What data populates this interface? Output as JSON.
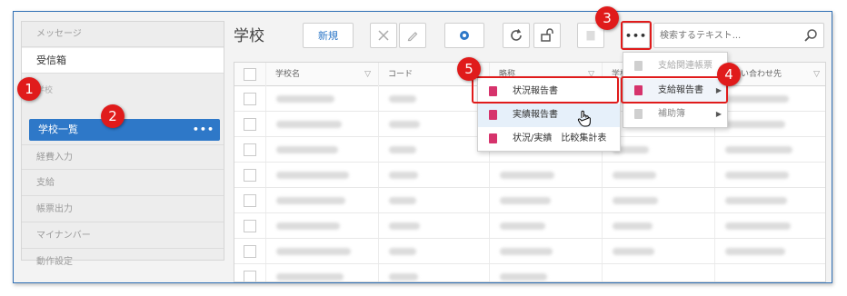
{
  "sidebar": {
    "items": [
      {
        "label": "メッセージ"
      },
      {
        "label": "受信箱"
      },
      {
        "label": "学校"
      },
      {
        "label": "学校一覧"
      },
      {
        "label": "経費入力"
      },
      {
        "label": "支給"
      },
      {
        "label": "帳票出力"
      },
      {
        "label": "マイナンバー"
      },
      {
        "label": "動作設定"
      }
    ],
    "active_more": "•••"
  },
  "header": {
    "title": "学校",
    "new_label": "新規",
    "more_label": "•••"
  },
  "search": {
    "placeholder": "検索するテキスト..."
  },
  "grid": {
    "columns": [
      "学校名",
      "コード",
      "略称",
      "学校",
      "等問い合わせ先"
    ]
  },
  "menu_main": {
    "items": [
      {
        "label": "支給関連帳票",
        "disabled": true
      },
      {
        "label": "支給報告書",
        "has_submenu": true
      },
      {
        "label": "補助簿",
        "has_submenu": true
      }
    ]
  },
  "menu_sub": {
    "items": [
      {
        "label": "状況報告書"
      },
      {
        "label": "実績報告書"
      },
      {
        "label": "状況/実績　比較集計表"
      }
    ]
  },
  "callouts": [
    "1",
    "2",
    "3",
    "4",
    "5"
  ],
  "colors": {
    "accent": "#2e78c8",
    "callout": "#e01b1b",
    "menu_icon": "#d6336c"
  }
}
